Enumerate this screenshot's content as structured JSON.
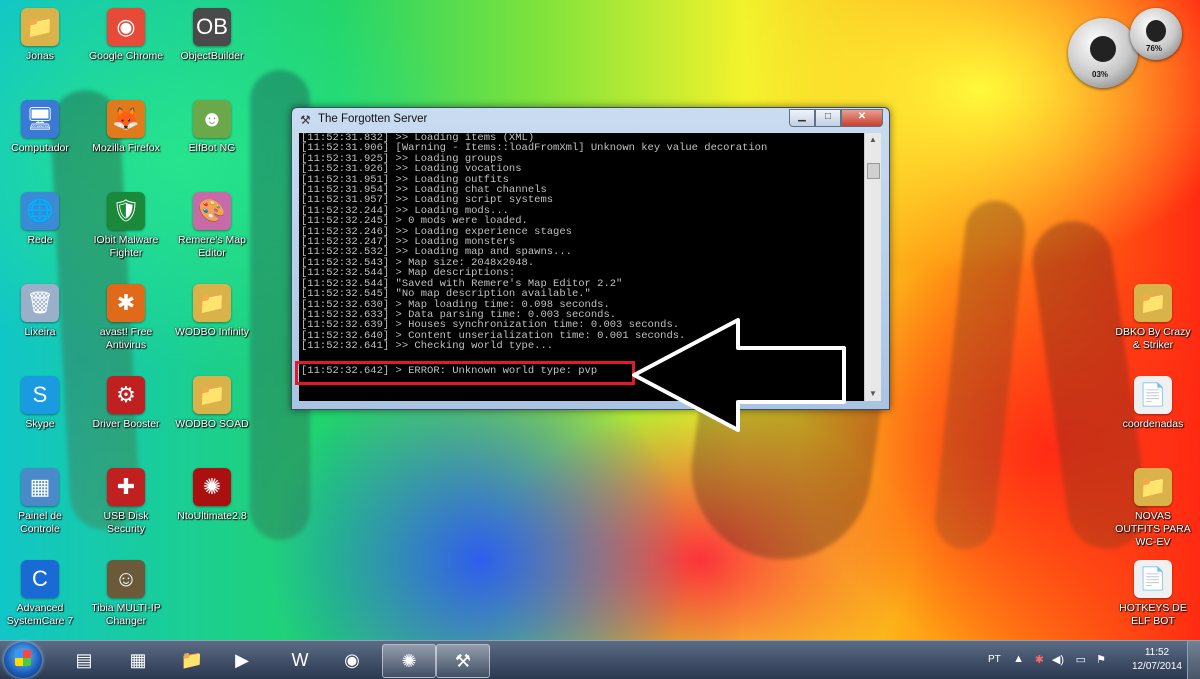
{
  "desktop": {
    "icons": [
      {
        "name": "jonas-folder",
        "label": "Jonas",
        "glyph": "📁"
      },
      {
        "name": "google-chrome-shortcut",
        "label": "Google Chrome",
        "glyph": "◉"
      },
      {
        "name": "objectbuilder-shortcut",
        "label": "ObjectBuilder",
        "glyph": "OB"
      },
      {
        "name": "computador-icon",
        "label": "Computador",
        "glyph": "🖥"
      },
      {
        "name": "mozilla-firefox-shortcut",
        "label": "Mozilla Firefox",
        "glyph": "🦊"
      },
      {
        "name": "elfbot-ng-shortcut",
        "label": "ElfBot NG",
        "glyph": "☻"
      },
      {
        "name": "rede-icon",
        "label": "Rede",
        "glyph": "🌐"
      },
      {
        "name": "iobit-malware-fighter-shortcut",
        "label": "IObit Malware Fighter",
        "glyph": "🛡"
      },
      {
        "name": "remeres-map-editor-shortcut",
        "label": "Remere's Map Editor",
        "glyph": "🎨"
      },
      {
        "name": "lixeira-icon",
        "label": "Lixeira",
        "glyph": "🗑"
      },
      {
        "name": "avast-free-antivirus-shortcut",
        "label": "avast! Free Antivirus",
        "glyph": "✱"
      },
      {
        "name": "wodbo-infinity-folder",
        "label": "WODBO Infinity",
        "glyph": "📁"
      },
      {
        "name": "skype-shortcut",
        "label": "Skype",
        "glyph": "S"
      },
      {
        "name": "driver-booster-shortcut",
        "label": "Driver Booster",
        "glyph": "⚙"
      },
      {
        "name": "wodbo-soad-folder",
        "label": "WODBO SOAD",
        "glyph": "📁"
      },
      {
        "name": "painel-de-controle-icon",
        "label": "Painel de Controle",
        "glyph": "▦"
      },
      {
        "name": "usb-disk-security-shortcut",
        "label": "USB Disk Security",
        "glyph": "✚"
      },
      {
        "name": "ntoultimate-shortcut",
        "label": "NtoUltimate2.8",
        "glyph": "✺"
      },
      {
        "name": "advanced-systemcare-shortcut",
        "label": "Advanced SystemCare 7",
        "glyph": "C"
      },
      {
        "name": "tibia-multi-ip-changer-shortcut",
        "label": "Tibia MULTI-IP Changer",
        "glyph": "☺"
      },
      {
        "name": "dbko-folder",
        "label": "DBKO By Crazy & Striker",
        "glyph": "📁"
      },
      {
        "name": "coordenadas-file",
        "label": "coordenadas",
        "glyph": "📄"
      },
      {
        "name": "novas-outfits-folder",
        "label": "NOVAS OUTFITS PARA WC-EV",
        "glyph": "📁"
      },
      {
        "name": "hotkeys-file",
        "label": "HOTKEYS DE ELF BOT",
        "glyph": "📄"
      }
    ]
  },
  "gadget": {
    "cpu_pct": "03%",
    "mem_pct": "76%"
  },
  "window": {
    "title": "The Forgotten Server",
    "controls": {
      "minimize": "▁",
      "maximize": "□",
      "close": "✕"
    },
    "lines": [
      "[11:52:31.832] >> Loading items (XML)",
      "[11:52:31.906] [Warning - Items::loadFromXml] Unknown key value decoration",
      "[11:52:31.925] >> Loading groups",
      "[11:52:31.926] >> Loading vocations",
      "[11:52:31.951] >> Loading outfits",
      "[11:52:31.954] >> Loading chat channels",
      "[11:52:31.957] >> Loading script systems",
      "[11:52:32.244] >> Loading mods...",
      "[11:52:32.245] > 0 mods were loaded.",
      "[11:52:32.246] >> Loading experience stages",
      "[11:52:32.247] >> Loading monsters",
      "[11:52:32.532] >> Loading map and spawns...",
      "[11:52:32.543] > Map size: 2048x2048.",
      "[11:52:32.544] > Map descriptions:",
      "[11:52:32.544] \"Saved with Remere's Map Editor 2.2\"",
      "[11:52:32.545] \"No map description available.\"",
      "[11:52:32.630] > Map loading time: 0.098 seconds.",
      "[11:52:32.633] > Data parsing time: 0.003 seconds.",
      "[11:52:32.639] > Houses synchronization time: 0.003 seconds.",
      "[11:52:32.640] > Content unserialization time: 0.001 seconds.",
      "[11:52:32.641] >> Checking world type..."
    ],
    "error_line": "[11:52:32.642] > ERROR: Unknown world type: pvp"
  },
  "taskbar": {
    "apps": [
      {
        "name": "taskbar-task-manager",
        "glyph": "▤"
      },
      {
        "name": "taskbar-control-panel",
        "glyph": "▦"
      },
      {
        "name": "taskbar-explorer",
        "glyph": "📁"
      },
      {
        "name": "taskbar-media-player",
        "glyph": "▶"
      },
      {
        "name": "taskbar-word",
        "glyph": "W"
      },
      {
        "name": "taskbar-chrome",
        "glyph": "◉"
      },
      {
        "name": "taskbar-ntoultimate",
        "glyph": "✺"
      },
      {
        "name": "taskbar-forgotten-server",
        "glyph": "⚒"
      }
    ],
    "language": "PT",
    "time": "11:52",
    "date": "12/07/2014"
  }
}
